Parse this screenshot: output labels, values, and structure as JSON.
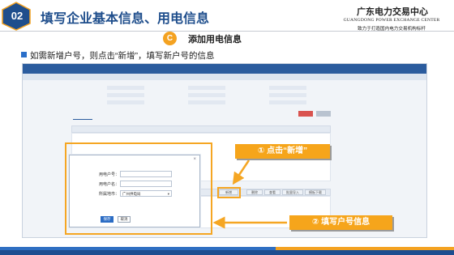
{
  "header": {
    "section_number": "02",
    "title": "填写企业基本信息、用电信息",
    "org_name": "广东电力交易中心",
    "org_name_en": "GUANGDONG POWER EXCHANGE CENTER",
    "org_slogan": "致力于打造国内电力交易机构标杆"
  },
  "section": {
    "badge": "C",
    "title": "添加用电信息"
  },
  "instruction": "如需新增户号，则点击“新增”，填写新户号的信息",
  "app": {
    "tool_buttons": [
      "新增",
      "删除",
      "查看",
      "批量导入",
      "模板下载"
    ],
    "dialog": {
      "close_glyph": "×",
      "fields": [
        {
          "label": "用电户号：",
          "value": ""
        },
        {
          "label": "用电户名：",
          "value": ""
        },
        {
          "label": "所属地市：",
          "value": "广州供电局"
        }
      ],
      "confirm_label": "保存",
      "cancel_label": "取消"
    }
  },
  "callouts": {
    "step1": "① 点击“新增”",
    "step2": "② 填写户号信息"
  },
  "colors": {
    "brand_blue": "#1f4e8c",
    "accent_orange": "#f5a623"
  }
}
